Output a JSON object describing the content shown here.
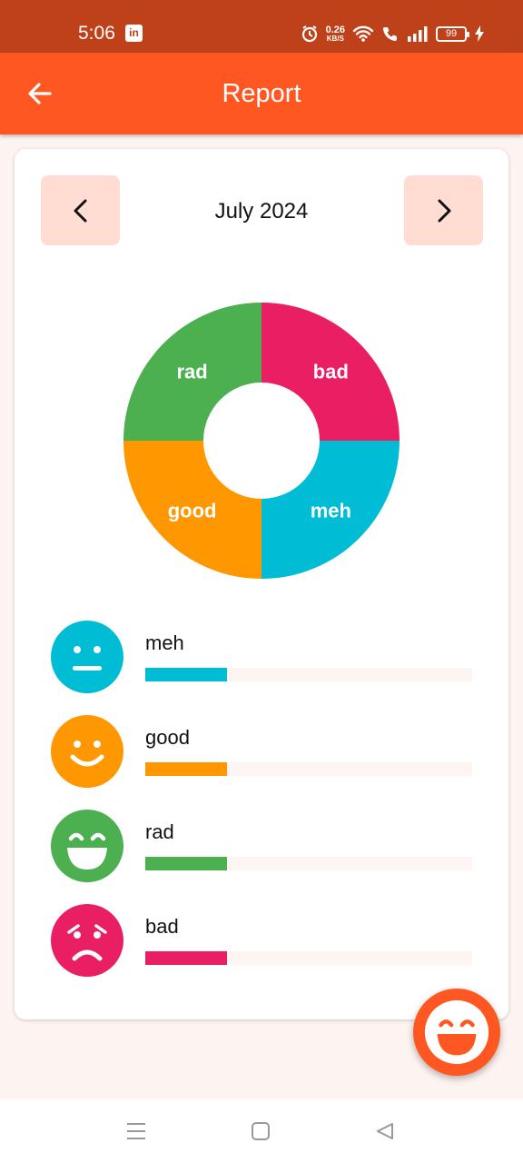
{
  "status_bar": {
    "time": "5:06",
    "app_icon": "linkedin-icon",
    "net_speed_value": "0.26",
    "net_speed_unit": "KB/S",
    "battery_level": "99",
    "icons": [
      "alarm-icon",
      "wifi-icon",
      "wifi-call-icon",
      "signal-icon",
      "battery-icon",
      "charging-icon"
    ]
  },
  "app_bar": {
    "title": "Report",
    "back_icon": "arrow-left-icon",
    "color": "#ff5722"
  },
  "report": {
    "month": "July 2024",
    "prev_icon": "chevron-left-icon",
    "next_icon": "chevron-right-icon"
  },
  "chart_data": {
    "type": "pie",
    "donut": true,
    "title": "",
    "categories": [
      "bad",
      "meh",
      "good",
      "rad"
    ],
    "values": [
      1,
      1,
      1,
      1
    ],
    "colors": [
      "#e91e63",
      "#00bcd4",
      "#ff9800",
      "#4caf50"
    ],
    "labels_on_slices": true
  },
  "moods": [
    {
      "name": "meh",
      "color": "#00bcd4",
      "icon": "neutral-face-icon",
      "fraction": 0.25
    },
    {
      "name": "good",
      "color": "#ff9800",
      "icon": "smiling-face-icon",
      "fraction": 0.25
    },
    {
      "name": "rad",
      "color": "#4caf50",
      "icon": "grinning-face-icon",
      "fraction": 0.25
    },
    {
      "name": "bad",
      "color": "#e91e63",
      "icon": "frowning-face-icon",
      "fraction": 0.25
    }
  ],
  "fab": {
    "icon": "grinning-face-icon",
    "color": "#ff5722"
  },
  "nav_bar": {
    "icons": [
      "menu-icon",
      "home-square-icon",
      "back-triangle-icon"
    ]
  }
}
